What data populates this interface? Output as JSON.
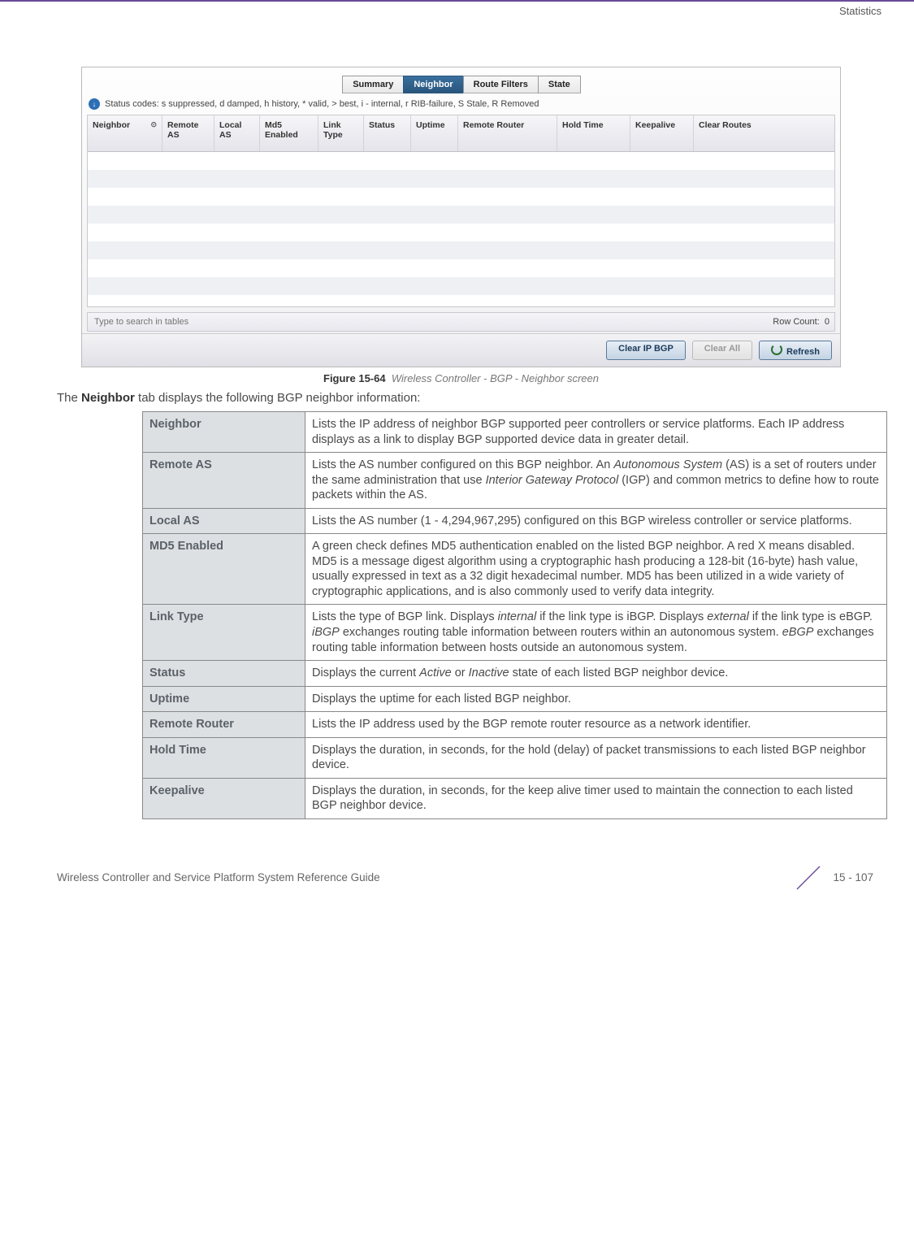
{
  "header": {
    "section": "Statistics"
  },
  "screenshot": {
    "tabs": [
      "Summary",
      "Neighbor",
      "Route Filters",
      "State"
    ],
    "active_tab_index": 1,
    "status_codes": "Status codes: s suppressed, d damped, h history, * valid, > best, i - internal, r RIB-failure, S Stale, R Removed",
    "columns": [
      "Neighbor",
      "Remote AS",
      "Local AS",
      "Md5 Enabled",
      "Link Type",
      "Status",
      "Uptime",
      "Remote Router",
      "Hold Time",
      "Keepalive",
      "Clear Routes"
    ],
    "sorted_col_index": 0,
    "search_placeholder": "Type to search in tables",
    "row_count_label": "Row Count:",
    "row_count_value": "0",
    "buttons": {
      "clear_ip_bgp": "Clear IP BGP",
      "clear_all": "Clear All",
      "refresh": "Refresh"
    }
  },
  "figure": {
    "label": "Figure 15-64",
    "caption": "Wireless Controller - BGP - Neighbor screen"
  },
  "intro": {
    "pre": "The ",
    "bold": "Neighbor",
    "post": " tab displays the following BGP neighbor information:"
  },
  "definitions": [
    {
      "term": "Neighbor",
      "desc": "Lists the IP address of neighbor BGP supported peer controllers or service platforms. Each IP address displays as a link to display BGP supported device data in greater detail."
    },
    {
      "term": "Remote AS",
      "desc": "Lists the AS number configured on this BGP neighbor. An <i>Autonomous System</i> (AS) is a set of routers under the same administration that use <i>Interior Gateway Protocol</i> (IGP) and common metrics to define how to route packets within the AS."
    },
    {
      "term": "Local AS",
      "desc": "Lists the AS number (1 - 4,294,967,295) configured on this BGP wireless controller or service platforms."
    },
    {
      "term": "MD5 Enabled",
      "desc": "A green check defines MD5 authentication enabled on the listed BGP neighbor. A red X means disabled. MD5 is a message digest algorithm using a cryptographic hash producing a 128-bit (16-byte) hash value, usually expressed in text as a 32 digit hexadecimal number. MD5 has been utilized in a wide variety of cryptographic applications, and is also commonly used to verify data integrity."
    },
    {
      "term": "Link Type",
      "desc": "Lists the type of BGP link. Displays <i>internal</i> if the link type is iBGP. Displays <i>external</i> if the link type is eBGP. <i>iBGP</i> exchanges routing table information between routers within an autonomous system. <i>eBGP</i> exchanges routing table information between hosts outside an autonomous system."
    },
    {
      "term": "Status",
      "desc": "Displays the current <i>Active</i> or <i>Inactive</i> state of each listed BGP neighbor device."
    },
    {
      "term": "Uptime",
      "desc": "Displays the uptime for each listed BGP neighbor."
    },
    {
      "term": "Remote Router",
      "desc": "Lists the IP address used by the BGP remote router resource as a network identifier."
    },
    {
      "term": "Hold Time",
      "desc": "Displays the duration, in seconds, for the hold (delay) of packet transmissions to each listed BGP neighbor device."
    },
    {
      "term": "Keepalive",
      "desc": "Displays the duration, in seconds, for the keep alive timer used to maintain the connection to each listed BGP neighbor device."
    }
  ],
  "footer": {
    "left": "Wireless Controller and Service Platform System Reference Guide",
    "right": "15 - 107"
  }
}
